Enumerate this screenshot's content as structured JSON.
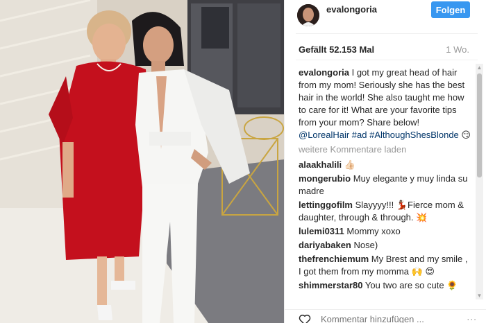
{
  "post": {
    "username": "evalongoria",
    "follow_label": "Folgen",
    "likes": "Gefällt 52.153 Mal",
    "time": "1 Wo."
  },
  "caption": {
    "user": "evalongoria",
    "text": "I got my great head of hair from my mom! Seriously she has the best hair in the world! She also taught me how to care for it! What are your favorite tips from your mom? Share below!",
    "mention": "@LorealHair",
    "hashtag1": "#ad",
    "hashtag2": "#AlthoughShesBlonde",
    "emoji": "😏"
  },
  "load_more": "weitere Kommentare laden",
  "comments": [
    {
      "user": "alaakhalili",
      "text": "👍🏻"
    },
    {
      "user": "mongerubio",
      "text": "Muy elegante y muy linda su madre"
    },
    {
      "user": "lettinggofilm",
      "text": "Slayyyy!!! 💃🏽Fierce mom & daughter, through & through. 💥"
    },
    {
      "user": "lulemi0311",
      "text": "Mommy xoxo"
    },
    {
      "user": "dariyabaken",
      "text": "Nose)"
    },
    {
      "user": "thefrenchiemum",
      "text": "My Brest and my smile , I got them from my momma 🙌 😍"
    },
    {
      "user": "shimmerstar80",
      "text": "You two are so cute 🌻"
    }
  ],
  "footer": {
    "comment_placeholder": "Kommentar hinzufügen ...",
    "more": "..."
  },
  "colors": {
    "accent": "#3897f0",
    "link": "#003569",
    "muted": "#999999"
  },
  "icons": {
    "like": "heart-icon",
    "more": "more-options-icon"
  }
}
